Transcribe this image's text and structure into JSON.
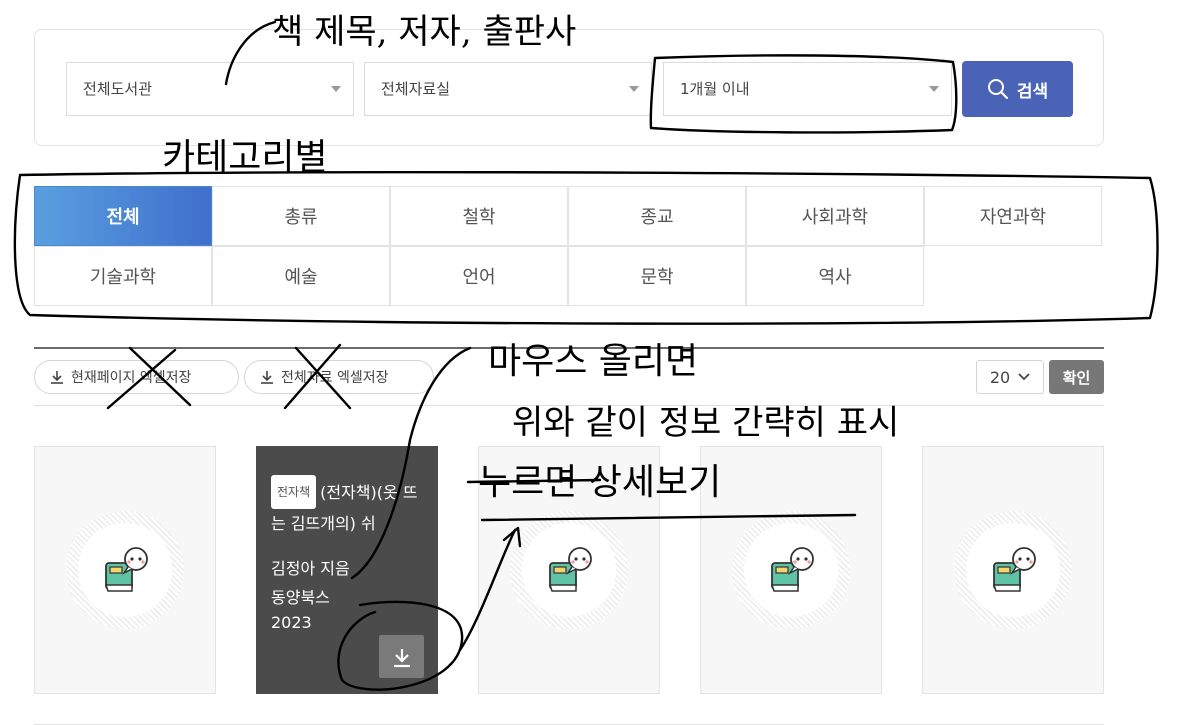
{
  "search": {
    "library": "전체도서관",
    "room": "전체자료실",
    "period": "1개월 이내",
    "button": "검색"
  },
  "categories": [
    "전체",
    "총류",
    "철학",
    "종교",
    "사회과학",
    "자연과학",
    "기술과학",
    "예술",
    "언어",
    "문학",
    "역사"
  ],
  "toolbar": {
    "export_page": "현재페이지 엑셀저장",
    "export_all": "전체자료 엑셀저장",
    "per_page": "20",
    "confirm": "확인"
  },
  "hover_card": {
    "tag": "전자책",
    "title": "(전자책)(옷 뜨는 김뜨개의) 쉬",
    "author": "김정아 지음",
    "publisher": "동양북스",
    "year": "2023"
  },
  "annotations": {
    "note_search": "책 제목, 저자, 출판사",
    "note_category": "카테고리별",
    "note_hover1": "마우스 올리면",
    "note_hover2": "위와 같이 정보 간략히 표시",
    "note_hover3": "누르면 상세보기"
  },
  "colors": {
    "accent": "#4a63b7",
    "active_start": "#5a9fe0",
    "active_end": "#3f6fcc",
    "hover_card": "#4b4b4b"
  }
}
